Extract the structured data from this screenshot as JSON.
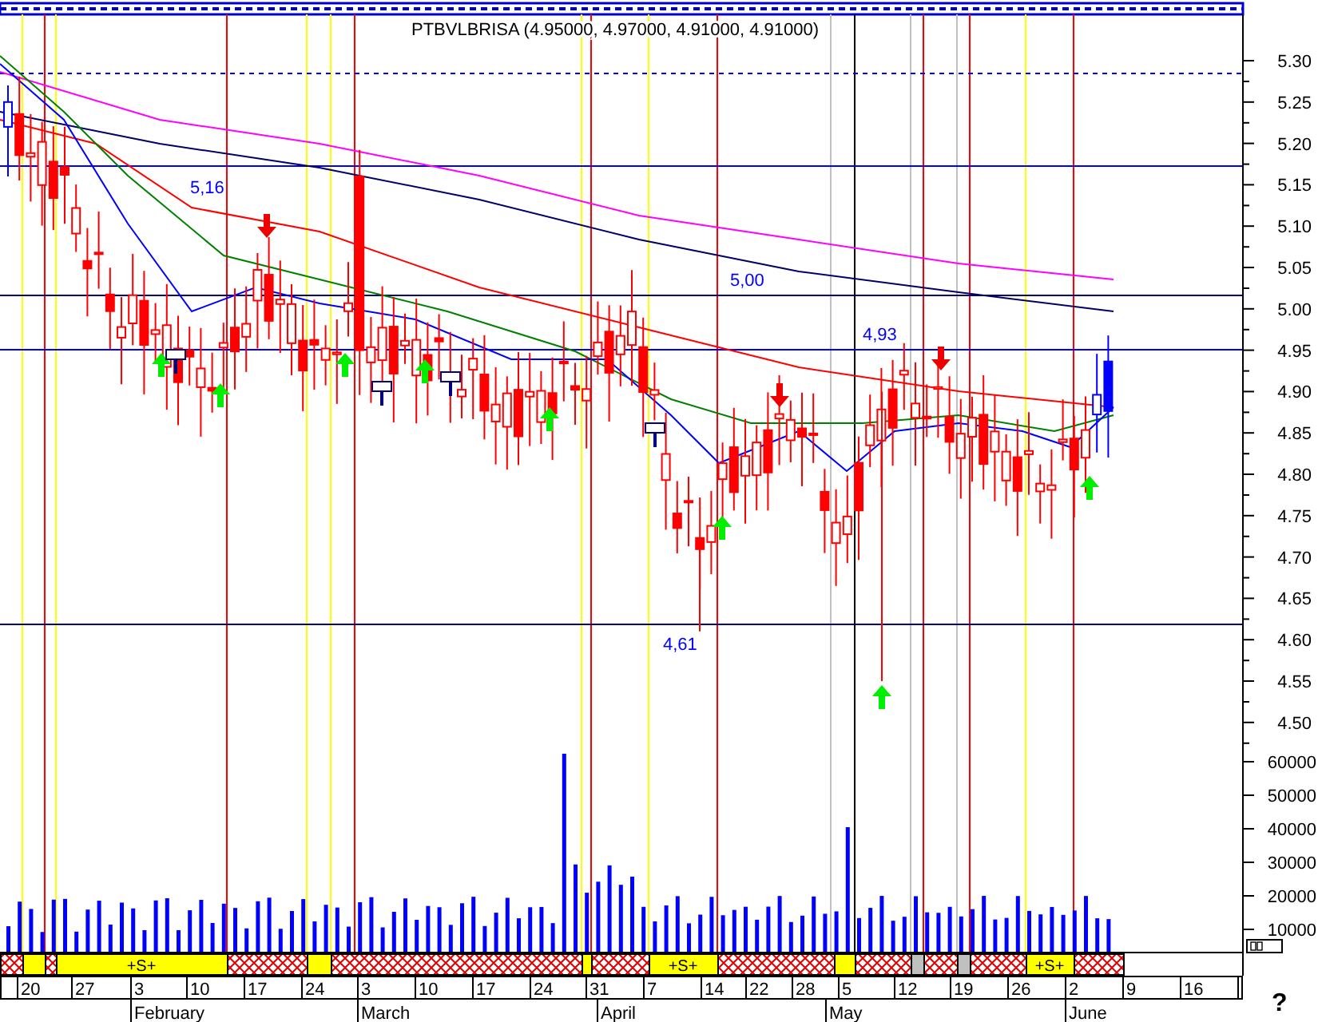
{
  "chart": {
    "title": "PTBVLBRISA (4.95000, 4.97000, 4.91000, 4.91000)",
    "annotations": [
      "5,16",
      "5,00",
      "4,93",
      "4,61"
    ],
    "price_axis": [
      "5.30",
      "5.25",
      "5.20",
      "5.15",
      "5.10",
      "5.05",
      "5.00",
      "4.95",
      "4.90",
      "4.85",
      "4.80",
      "4.75",
      "4.70",
      "4.65",
      "4.60",
      "4.55",
      "4.50"
    ],
    "volume_axis": [
      "60000",
      "50000",
      "40000",
      "30000",
      "20000",
      "10000"
    ]
  },
  "signal_strip": [
    {
      "kind": "hatched"
    },
    {
      "kind": "yellow"
    },
    {
      "kind": "hatched"
    },
    {
      "kind": "yellow",
      "label": "+S+"
    },
    {
      "kind": "hatched"
    },
    {
      "kind": "yellow"
    },
    {
      "kind": "hatched"
    },
    {
      "kind": "yellow"
    },
    {
      "kind": "hatched"
    },
    {
      "kind": "yellow",
      "label": "+S+"
    },
    {
      "kind": "hatched"
    },
    {
      "kind": "yellow"
    },
    {
      "kind": "hatched"
    },
    {
      "kind": "gray"
    },
    {
      "kind": "hatched"
    },
    {
      "kind": "gray"
    },
    {
      "kind": "hatched"
    },
    {
      "kind": "yellow",
      "label": "+S+"
    },
    {
      "kind": "hatched"
    }
  ],
  "date_axis": {
    "days": [
      "20",
      "27",
      "3",
      "10",
      "17",
      "24",
      "3",
      "10",
      "17",
      "24",
      "31",
      "7",
      "14",
      "22",
      "28",
      "5",
      "12",
      "19",
      "26",
      "2",
      "9",
      "16"
    ],
    "months": [
      "February",
      "March",
      "April",
      "May",
      "June"
    ]
  },
  "help_button": "?"
}
